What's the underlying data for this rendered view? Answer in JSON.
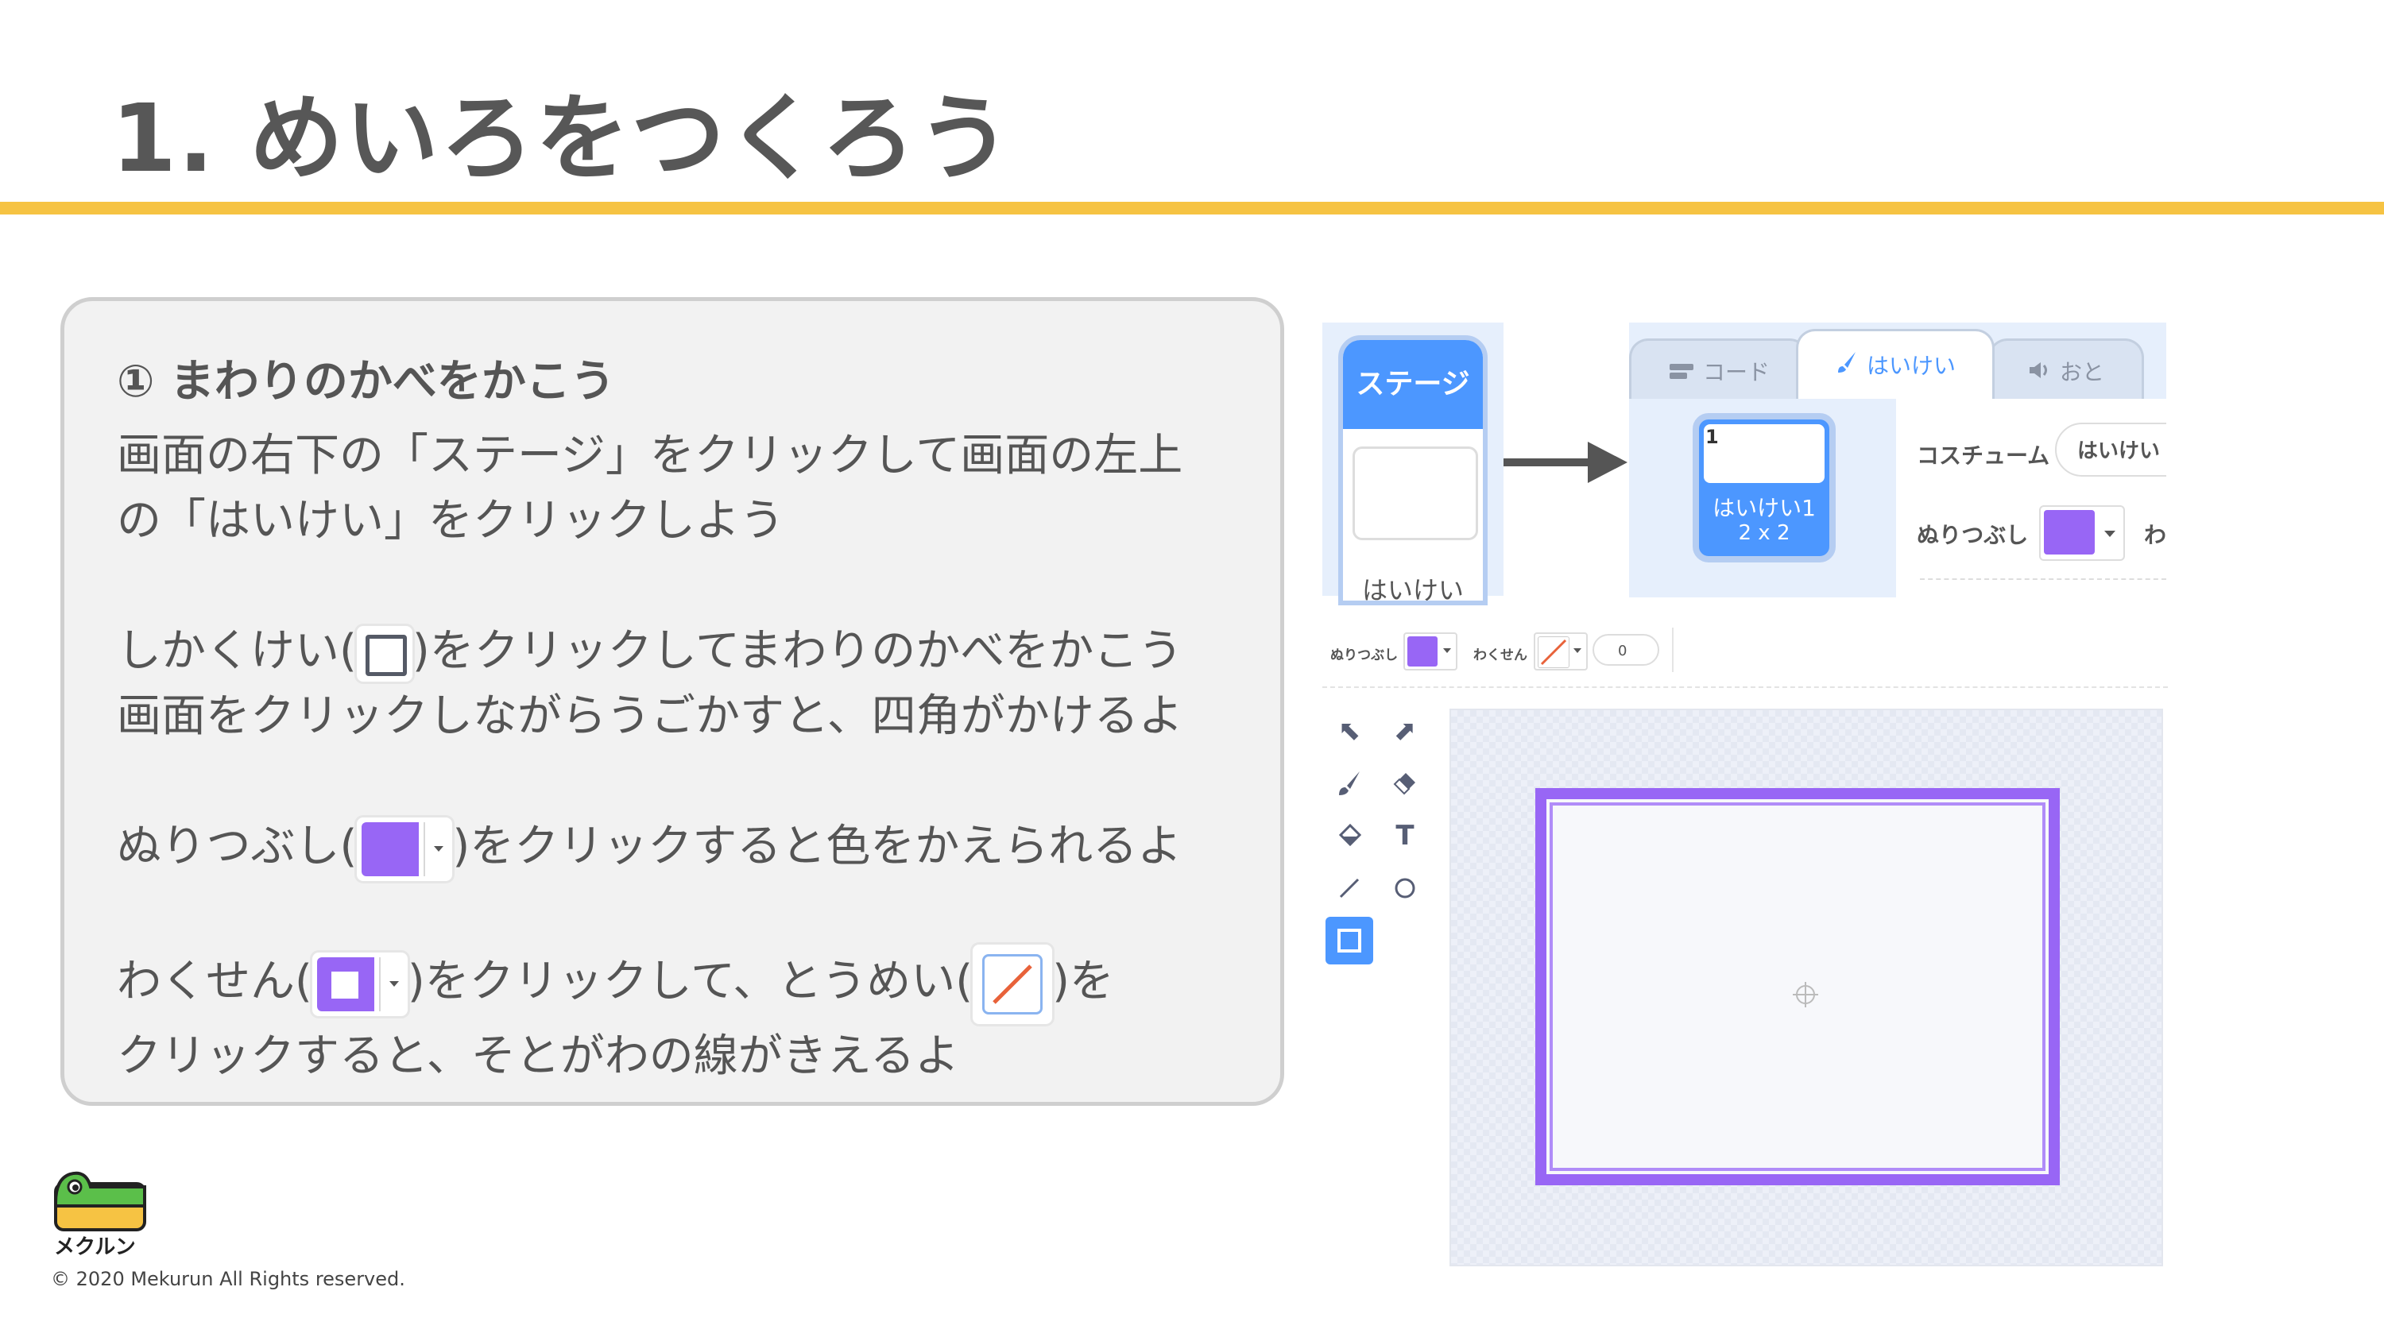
{
  "slide": {
    "title": "1. めいろをつくろう",
    "accent_color": "#f6c343"
  },
  "card": {
    "heading": "① まわりのかべをかこう",
    "para1_line1": "画面の右下の「ステージ」をクリックして画面の左上",
    "para1_line2": "の「はいけい」をクリックしよう",
    "para2_prefix": "しかくけい(",
    "para2_suffix": ")をクリックしてまわりのかべをかこう",
    "para2_line2": "画面をクリックしながらうごかすと、四角がかけるよ",
    "para3_prefix": "ぬりつぶし(",
    "para3_suffix": ")をクリックすると色をかえられるよ",
    "para4_prefix": "わくせん(",
    "para4_middle": ")をクリックして、とうめい(",
    "para4_suffix": ")を",
    "para4_line2": "クリックすると、そとがわの線がきえるよ"
  },
  "footer": {
    "logo_text": "メクルン",
    "copyright": "© 2020 Mekurun All Rights reserved."
  },
  "stage_panel": {
    "header": "ステージ",
    "label": "はいけい"
  },
  "editor": {
    "tabs": [
      {
        "label": "コード",
        "icon": "code-icon"
      },
      {
        "label": "はいけい",
        "icon": "brush-icon"
      },
      {
        "label": "おと",
        "icon": "speaker-icon"
      }
    ],
    "costume": {
      "number": "1",
      "name": "はいけい1",
      "size": "2 x 2"
    },
    "costume_label": "コスチューム",
    "costume_name_value": "はいけい",
    "fill_label": "ぬりつぶし",
    "outline_label_cut": "わ"
  },
  "paint_toolbar": {
    "fill_label": "ぬりつぶし",
    "outline_label": "わくせん",
    "outline_width": "0"
  },
  "colors": {
    "purple": "#9866f5",
    "scratch_blue": "#4c97ff"
  }
}
